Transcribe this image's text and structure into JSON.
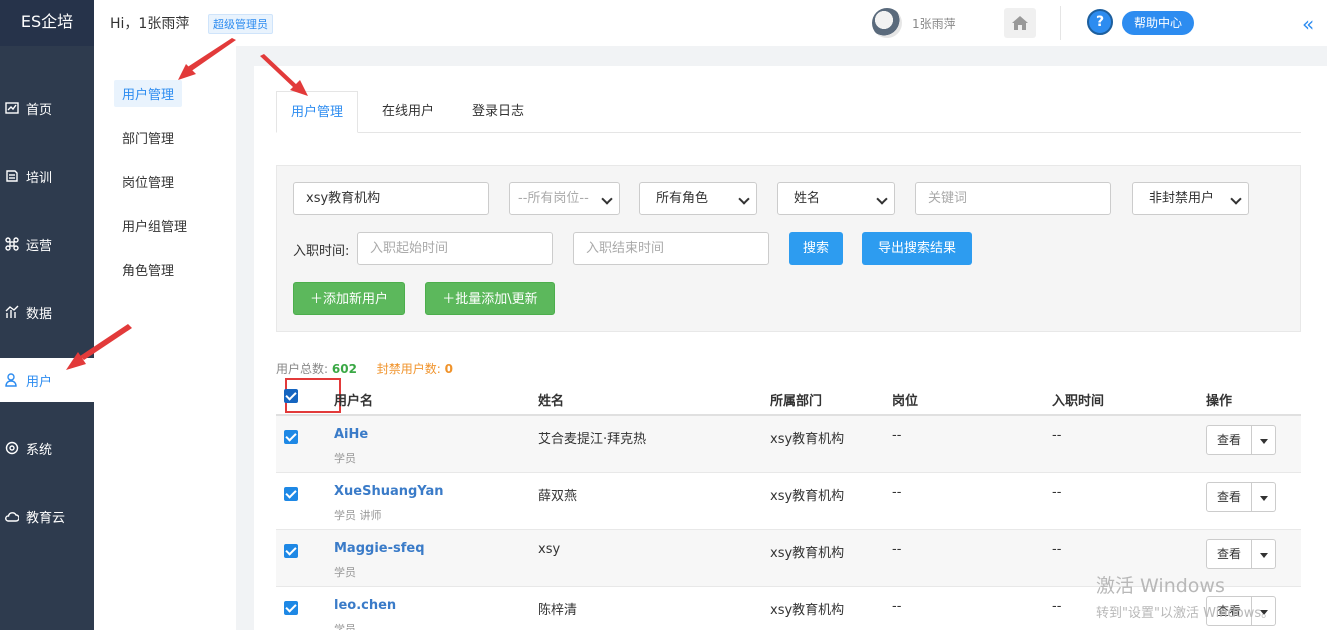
{
  "brand": "ES企培",
  "nav": [
    {
      "label": "首页",
      "icon": "dashboard-icon"
    },
    {
      "label": "培训",
      "icon": "book-icon"
    },
    {
      "label": "运营",
      "icon": "command-icon"
    },
    {
      "label": "数据",
      "icon": "chart-icon"
    },
    {
      "label": "用户",
      "icon": "user-icon",
      "active": true
    },
    {
      "label": "系统",
      "icon": "gear-icon"
    },
    {
      "label": "教育云",
      "icon": "cloud-icon"
    }
  ],
  "header": {
    "greeting": "Hi，1张雨萍",
    "badge": "超级管理员",
    "username": "1张雨萍",
    "help_label": "帮助中心",
    "help_q": "?",
    "collapse": "«"
  },
  "subnav": [
    "用户管理",
    "部门管理",
    "岗位管理",
    "用户组管理",
    "角色管理"
  ],
  "tabs": [
    "用户管理",
    "在线用户",
    "登录日志"
  ],
  "filters": {
    "org_value": "xsy教育机构",
    "post_select": "--所有岗位--",
    "role_select": "所有角色",
    "name_select": "姓名",
    "keyword_placeholder": "关键词",
    "ban_select": "非封禁用户",
    "hire_label": "入职时间:",
    "start_placeholder": "入职起始时间",
    "end_placeholder": "入职结束时间",
    "search_label": "搜索",
    "export_label": "导出搜索结果",
    "add_label": "＋添加新用户",
    "batch_label": "＋批量添加\\更新"
  },
  "stats": {
    "total_label": "用户总数:",
    "total_value": "602",
    "banned_label": "封禁用户数:",
    "banned_value": "0"
  },
  "columns": [
    "用户名",
    "姓名",
    "所属部门",
    "岗位",
    "入职时间",
    "操作"
  ],
  "rows": [
    {
      "username": "AiHe",
      "roles": "学员",
      "name": "艾合麦提江·拜克热",
      "dept": "xsy教育机构",
      "post": "--",
      "hire": "--",
      "action": "查看"
    },
    {
      "username": "XueShuangYan",
      "roles": "学员   讲师",
      "name": "薛双燕",
      "dept": "xsy教育机构",
      "post": "--",
      "hire": "--",
      "action": "查看"
    },
    {
      "username": "Maggie-sfeq",
      "roles": "学员",
      "name": "xsy",
      "dept": "xsy教育机构",
      "post": "--",
      "hire": "--",
      "action": "查看"
    },
    {
      "username": "leo.chen",
      "roles": "学员",
      "name": "陈梓清",
      "dept": "xsy教育机构",
      "post": "--",
      "hire": "--",
      "action": "查看"
    }
  ],
  "watermark": {
    "line1": "激活 Windows",
    "line2": "转到\"设置\"以激活 Windows。"
  },
  "colors": {
    "accent": "#2d8cf0",
    "sidebar": "#2e3b4e",
    "green": "#5cb85c",
    "highlight": "#e23a3a"
  }
}
